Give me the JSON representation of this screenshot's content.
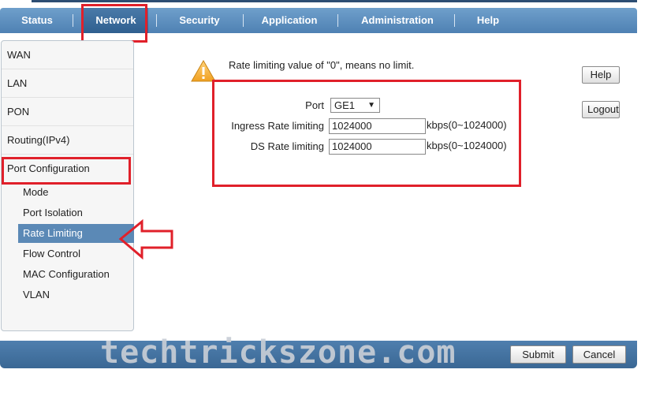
{
  "nav": {
    "items": [
      "Status",
      "Network",
      "Security",
      "Application",
      "Administration",
      "Help"
    ],
    "active": "Network"
  },
  "sidebar": {
    "items": [
      "WAN",
      "LAN",
      "PON",
      "Routing(IPv4)",
      "Port Configuration"
    ],
    "subitems": [
      "Mode",
      "Port Isolation",
      "Rate Limiting",
      "Flow Control",
      "MAC Configuration",
      "VLAN"
    ],
    "active_sub": "Rate Limiting"
  },
  "content": {
    "notice": "Rate limiting value of \"0\", means no limit.",
    "help_button": "Help",
    "logout_button": "Logout",
    "port_label": "Port",
    "port_value": "GE1",
    "ingress_label": "Ingress Rate limiting",
    "ingress_value": "1024000",
    "ingress_unit": "kbps(0~1024000)",
    "ds_label": "DS Rate limiting",
    "ds_value": "1024000",
    "ds_unit": "kbps(0~1024000)"
  },
  "footer": {
    "submit": "Submit",
    "cancel": "Cancel",
    "watermark": "techtrickszone.com"
  },
  "colors": {
    "nav_bar": "#5b8cbd",
    "highlight_red": "#e0202a",
    "active_sub": "#5b89b6"
  }
}
